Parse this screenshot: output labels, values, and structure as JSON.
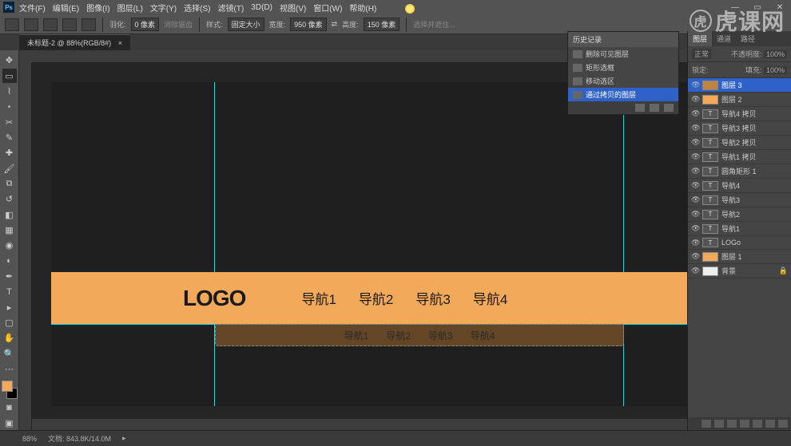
{
  "menu": [
    "文件(F)",
    "编辑(E)",
    "图像(I)",
    "图层(L)",
    "文字(Y)",
    "选择(S)",
    "滤镜(T)",
    "3D(D)",
    "视图(V)",
    "窗口(W)",
    "帮助(H)"
  ],
  "options": {
    "feather_label": "羽化:",
    "feather_value": "0 像素",
    "antialias": "消除锯齿",
    "style_label": "样式:",
    "style_value": "固定大小",
    "width_label": "宽度:",
    "width_value": "950 像素",
    "height_label": "高度:",
    "height_value": "150 像素",
    "refine": "选择并遮住..."
  },
  "doc_tab": "未标题-2 @ 88%(RGB/8#)",
  "banner": {
    "logo": "LOGO",
    "nav": [
      "导航1",
      "导航2",
      "导航3",
      "导航4"
    ],
    "subnav": [
      "导航1",
      "导航2",
      "导航3",
      "导航4"
    ]
  },
  "history": {
    "title": "历史记录",
    "items": [
      "删除可见图层",
      "矩形选框",
      "移动选区",
      "通过拷贝的图层"
    ]
  },
  "layers_panel": {
    "tabs": [
      "图层",
      "通道",
      "路径"
    ],
    "mode_label": "正常",
    "opacity_label": "不透明度:",
    "opacity_value": "100%",
    "lock_label": "锁定:",
    "fill_label": "填充:",
    "fill_value": "100%",
    "layers": [
      {
        "name": "图层 3",
        "type": "dorange",
        "sel": true
      },
      {
        "name": "图层 2",
        "type": "orange"
      },
      {
        "name": "导航4 拷贝",
        "type": "text"
      },
      {
        "name": "导航3 拷贝",
        "type": "text"
      },
      {
        "name": "导航2 拷贝",
        "type": "text"
      },
      {
        "name": "导航1 拷贝",
        "type": "text"
      },
      {
        "name": "圆角矩形 1",
        "type": "text"
      },
      {
        "name": "导航4",
        "type": "text"
      },
      {
        "name": "导航3",
        "type": "text"
      },
      {
        "name": "导航2",
        "type": "text"
      },
      {
        "name": "导航1",
        "type": "text"
      },
      {
        "name": "LOGo",
        "type": "text"
      },
      {
        "name": "图层 1",
        "type": "orange"
      },
      {
        "name": "背景",
        "type": "white",
        "lock": true
      }
    ]
  },
  "status": {
    "zoom": "88%",
    "docinfo": "文档: 843.8K/14.0M"
  },
  "watermark": "虎课网"
}
